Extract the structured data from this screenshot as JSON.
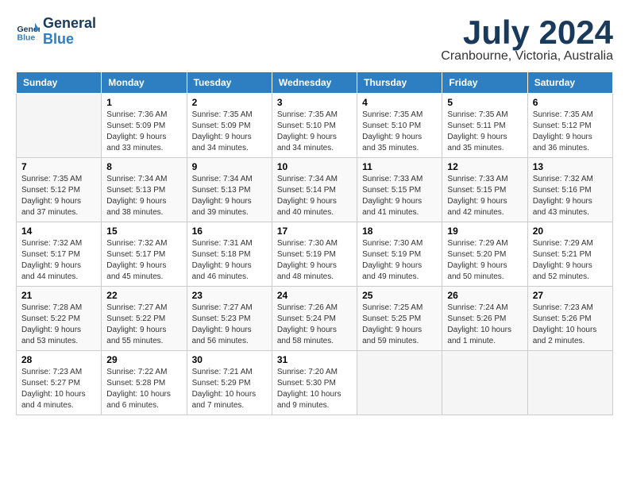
{
  "logo": {
    "line1": "General",
    "line2": "Blue"
  },
  "title": "July 2024",
  "location": "Cranbourne, Victoria, Australia",
  "days_header": [
    "Sunday",
    "Monday",
    "Tuesday",
    "Wednesday",
    "Thursday",
    "Friday",
    "Saturday"
  ],
  "weeks": [
    [
      {
        "day": "",
        "info": ""
      },
      {
        "day": "1",
        "info": "Sunrise: 7:36 AM\nSunset: 5:09 PM\nDaylight: 9 hours\nand 33 minutes."
      },
      {
        "day": "2",
        "info": "Sunrise: 7:35 AM\nSunset: 5:09 PM\nDaylight: 9 hours\nand 34 minutes."
      },
      {
        "day": "3",
        "info": "Sunrise: 7:35 AM\nSunset: 5:10 PM\nDaylight: 9 hours\nand 34 minutes."
      },
      {
        "day": "4",
        "info": "Sunrise: 7:35 AM\nSunset: 5:10 PM\nDaylight: 9 hours\nand 35 minutes."
      },
      {
        "day": "5",
        "info": "Sunrise: 7:35 AM\nSunset: 5:11 PM\nDaylight: 9 hours\nand 35 minutes."
      },
      {
        "day": "6",
        "info": "Sunrise: 7:35 AM\nSunset: 5:12 PM\nDaylight: 9 hours\nand 36 minutes."
      }
    ],
    [
      {
        "day": "7",
        "info": "Sunrise: 7:35 AM\nSunset: 5:12 PM\nDaylight: 9 hours\nand 37 minutes."
      },
      {
        "day": "8",
        "info": "Sunrise: 7:34 AM\nSunset: 5:13 PM\nDaylight: 9 hours\nand 38 minutes."
      },
      {
        "day": "9",
        "info": "Sunrise: 7:34 AM\nSunset: 5:13 PM\nDaylight: 9 hours\nand 39 minutes."
      },
      {
        "day": "10",
        "info": "Sunrise: 7:34 AM\nSunset: 5:14 PM\nDaylight: 9 hours\nand 40 minutes."
      },
      {
        "day": "11",
        "info": "Sunrise: 7:33 AM\nSunset: 5:15 PM\nDaylight: 9 hours\nand 41 minutes."
      },
      {
        "day": "12",
        "info": "Sunrise: 7:33 AM\nSunset: 5:15 PM\nDaylight: 9 hours\nand 42 minutes."
      },
      {
        "day": "13",
        "info": "Sunrise: 7:32 AM\nSunset: 5:16 PM\nDaylight: 9 hours\nand 43 minutes."
      }
    ],
    [
      {
        "day": "14",
        "info": "Sunrise: 7:32 AM\nSunset: 5:17 PM\nDaylight: 9 hours\nand 44 minutes."
      },
      {
        "day": "15",
        "info": "Sunrise: 7:32 AM\nSunset: 5:17 PM\nDaylight: 9 hours\nand 45 minutes."
      },
      {
        "day": "16",
        "info": "Sunrise: 7:31 AM\nSunset: 5:18 PM\nDaylight: 9 hours\nand 46 minutes."
      },
      {
        "day": "17",
        "info": "Sunrise: 7:30 AM\nSunset: 5:19 PM\nDaylight: 9 hours\nand 48 minutes."
      },
      {
        "day": "18",
        "info": "Sunrise: 7:30 AM\nSunset: 5:19 PM\nDaylight: 9 hours\nand 49 minutes."
      },
      {
        "day": "19",
        "info": "Sunrise: 7:29 AM\nSunset: 5:20 PM\nDaylight: 9 hours\nand 50 minutes."
      },
      {
        "day": "20",
        "info": "Sunrise: 7:29 AM\nSunset: 5:21 PM\nDaylight: 9 hours\nand 52 minutes."
      }
    ],
    [
      {
        "day": "21",
        "info": "Sunrise: 7:28 AM\nSunset: 5:22 PM\nDaylight: 9 hours\nand 53 minutes."
      },
      {
        "day": "22",
        "info": "Sunrise: 7:27 AM\nSunset: 5:22 PM\nDaylight: 9 hours\nand 55 minutes."
      },
      {
        "day": "23",
        "info": "Sunrise: 7:27 AM\nSunset: 5:23 PM\nDaylight: 9 hours\nand 56 minutes."
      },
      {
        "day": "24",
        "info": "Sunrise: 7:26 AM\nSunset: 5:24 PM\nDaylight: 9 hours\nand 58 minutes."
      },
      {
        "day": "25",
        "info": "Sunrise: 7:25 AM\nSunset: 5:25 PM\nDaylight: 9 hours\nand 59 minutes."
      },
      {
        "day": "26",
        "info": "Sunrise: 7:24 AM\nSunset: 5:26 PM\nDaylight: 10 hours\nand 1 minute."
      },
      {
        "day": "27",
        "info": "Sunrise: 7:23 AM\nSunset: 5:26 PM\nDaylight: 10 hours\nand 2 minutes."
      }
    ],
    [
      {
        "day": "28",
        "info": "Sunrise: 7:23 AM\nSunset: 5:27 PM\nDaylight: 10 hours\nand 4 minutes."
      },
      {
        "day": "29",
        "info": "Sunrise: 7:22 AM\nSunset: 5:28 PM\nDaylight: 10 hours\nand 6 minutes."
      },
      {
        "day": "30",
        "info": "Sunrise: 7:21 AM\nSunset: 5:29 PM\nDaylight: 10 hours\nand 7 minutes."
      },
      {
        "day": "31",
        "info": "Sunrise: 7:20 AM\nSunset: 5:30 PM\nDaylight: 10 hours\nand 9 minutes."
      },
      {
        "day": "",
        "info": ""
      },
      {
        "day": "",
        "info": ""
      },
      {
        "day": "",
        "info": ""
      }
    ]
  ]
}
